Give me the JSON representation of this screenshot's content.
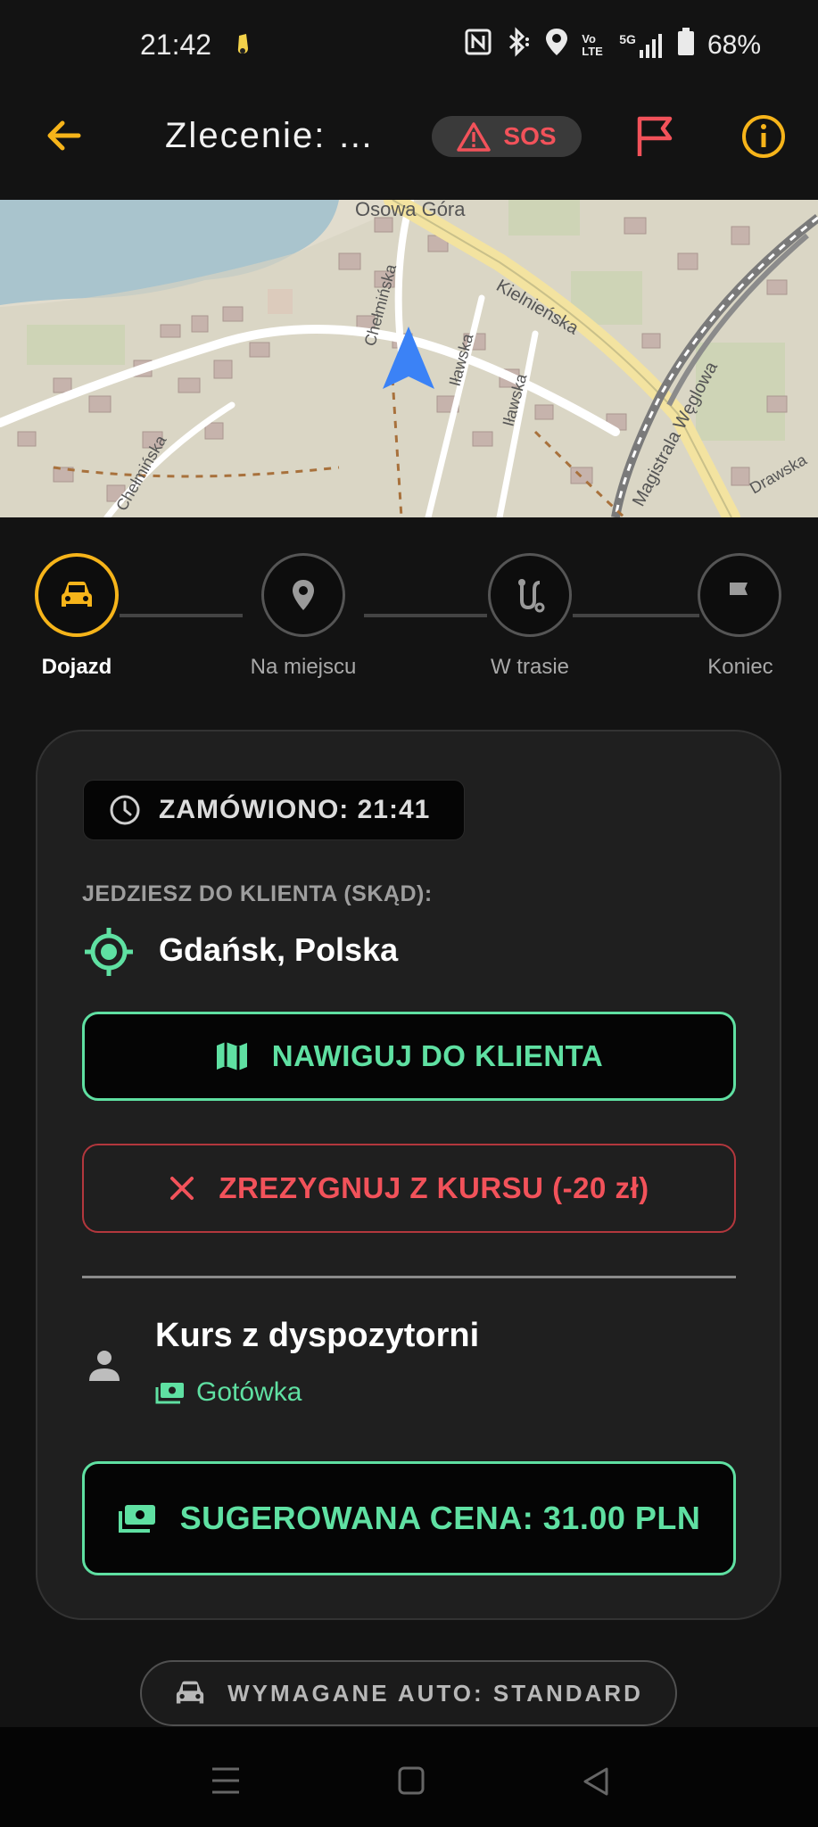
{
  "status_bar": {
    "time": "21:42",
    "volte": "Vo LTE",
    "network": "5G",
    "battery": "68%"
  },
  "header": {
    "title": "Zlecenie: …",
    "sos_label": "SOS"
  },
  "map": {
    "labels": [
      "Osowa Góra",
      "Chełmińska",
      "Kielnieńska",
      "Iławska",
      "Iławska",
      "Chełmińska",
      "Magistrala Węglowa",
      "Drawska"
    ]
  },
  "stepper": {
    "steps": [
      {
        "label": "Dojazd",
        "icon": "car-icon",
        "active": true
      },
      {
        "label": "Na miejscu",
        "icon": "location-pin-icon",
        "active": false
      },
      {
        "label": "W trasie",
        "icon": "route-icon",
        "active": false
      },
      {
        "label": "Koniec",
        "icon": "flag-icon",
        "active": false
      }
    ]
  },
  "card": {
    "ordered_chip": "ZAMÓWIONO: 21:41",
    "destination_label": "JEDZIESZ DO KLIENTA (SKĄD):",
    "location": "Gdańsk, Polska",
    "navigate_button": "NAWIGUJ DO KLIENTA",
    "resign_button": "ZREZYGNUJ Z KURSU (-20 zł)",
    "course_title": "Kurs z dyspozytorni",
    "payment": "Gotówka",
    "price_button": "SUGEROWANA CENA: 31.00 PLN"
  },
  "required_car": "WYMAGANE AUTO: STANDARD",
  "colors": {
    "accent_yellow": "#f6b41a",
    "accent_green": "#5fe0a2",
    "danger_red": "#f2525a",
    "background": "#131313"
  }
}
